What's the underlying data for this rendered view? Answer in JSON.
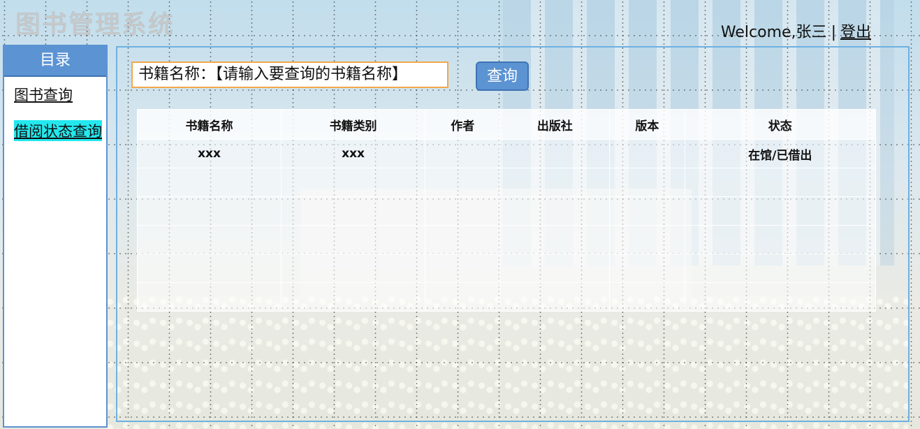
{
  "app_title": "图书管理系统",
  "user": {
    "welcome": "Welcome,张三",
    "separator": "|",
    "logout": "登出"
  },
  "sidebar": {
    "header": "目录",
    "items": [
      {
        "label": "图书查询"
      },
      {
        "label": "借阅状态查询"
      }
    ]
  },
  "search": {
    "label_text": "书籍名称：【请输入要查询的书籍名称】",
    "button_label": "查询"
  },
  "table": {
    "columns": [
      "书籍名称",
      "书籍类别",
      "作者",
      "出版社",
      "版本",
      "状态"
    ],
    "rows": [
      [
        "xxx",
        "xxx",
        "",
        "",
        "",
        "在馆/已借出"
      ],
      [
        "",
        "",
        "",
        "",
        "",
        ""
      ],
      [
        "",
        "",
        "",
        "",
        "",
        ""
      ],
      [
        "",
        "",
        "",
        "",
        "",
        ""
      ],
      [
        "",
        "",
        "",
        "",
        "",
        ""
      ],
      [
        "",
        "",
        "",
        "",
        "",
        ""
      ]
    ]
  }
}
